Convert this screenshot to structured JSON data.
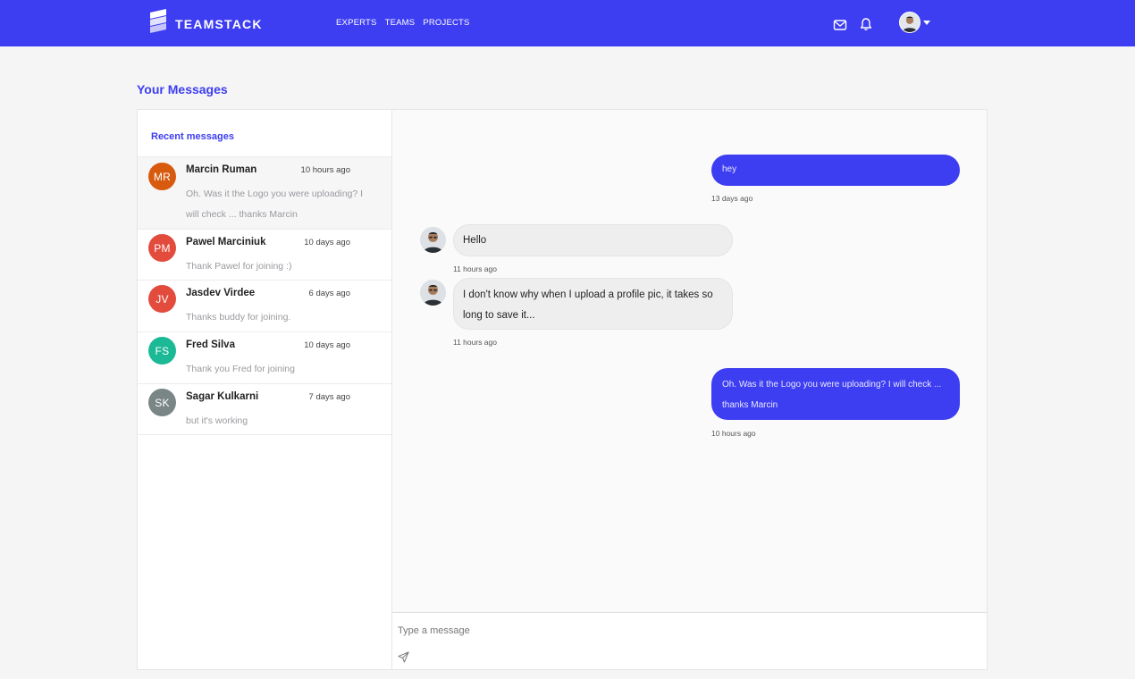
{
  "brand": {
    "name": "TEAMSTACK"
  },
  "nav": {
    "links": [
      "EXPERTS",
      "TEAMS",
      "PROJECTS"
    ],
    "icons": {
      "mail": "mail-icon",
      "notifications": "bell-icon",
      "menu": "chevron-down-icon"
    }
  },
  "page": {
    "title": "Your Messages"
  },
  "sidebar": {
    "header": "Recent messages",
    "conversations": [
      {
        "initials": "MR",
        "name": "Marcin Ruman",
        "time": "10 hours ago",
        "preview": "Oh. Was it the Logo you were uploading? I will check ... thanks Marcin",
        "color": "#d75a0f",
        "active": true
      },
      {
        "initials": "PM",
        "name": "Pawel Marciniuk",
        "time": "10 days ago",
        "preview": "Thank Pawel for joining :)",
        "color": "#e34b3c",
        "active": false
      },
      {
        "initials": "JV",
        "name": "Jasdev Virdee",
        "time": "6 days ago",
        "preview": "Thanks buddy for joining.",
        "color": "#e34b3c",
        "active": false
      },
      {
        "initials": "FS",
        "name": "Fred Silva",
        "time": "10 days ago",
        "preview": "Thank you Fred for joining",
        "color": "#1bb996",
        "active": false
      },
      {
        "initials": "SK",
        "name": "Sagar Kulkarni",
        "time": "7 days ago",
        "preview": "but it's working",
        "color": "#7a8586",
        "active": false
      }
    ]
  },
  "chat": {
    "messages": [
      {
        "direction": "outgoing",
        "text": "hey",
        "time": "13 days ago"
      },
      {
        "direction": "incoming",
        "text": "Hello",
        "time": "11 hours ago"
      },
      {
        "direction": "incoming",
        "text": "I don't know why when I upload a profile pic, it takes so long to save it...",
        "time": "11 hours ago"
      },
      {
        "direction": "outgoing",
        "text": "Oh. Was it the Logo you were uploading? I will check ... thanks Marcin",
        "time": "10 hours ago"
      }
    ],
    "composer": {
      "placeholder": "Type a message",
      "send_icon": "send-icon"
    }
  },
  "colors": {
    "accent": "#3d3df2",
    "incoming_bubble": "#eeeeef",
    "background": "#f5f5f6"
  }
}
